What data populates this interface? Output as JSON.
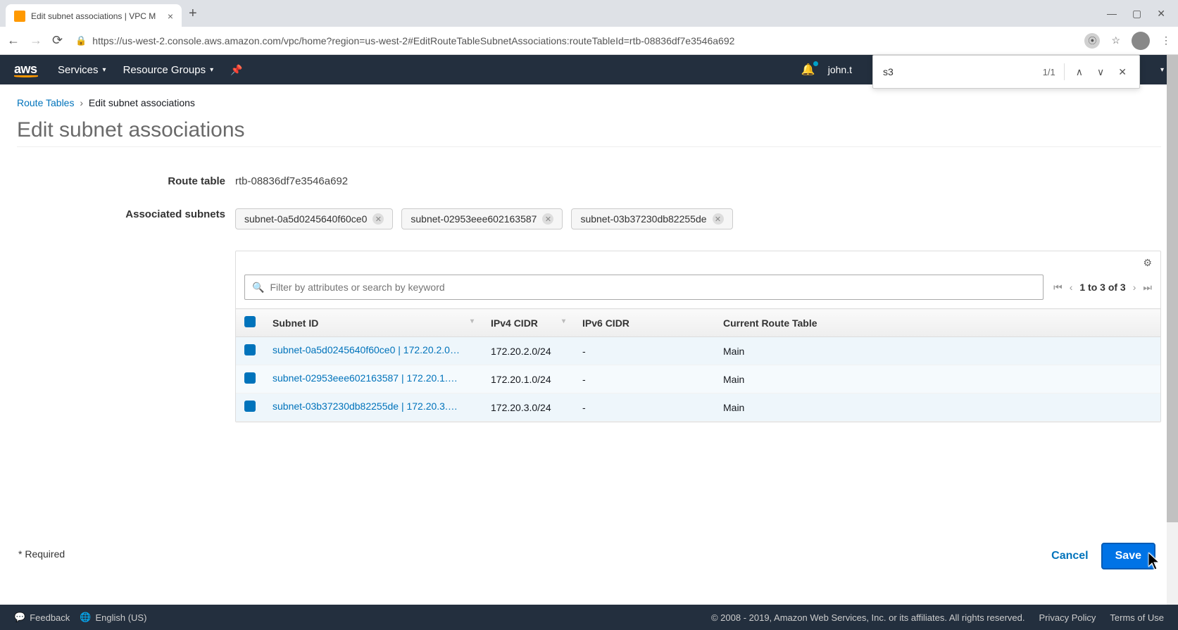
{
  "browser": {
    "tab_title": "Edit subnet associations | VPC M",
    "url_display": "https://us-west-2.console.aws.amazon.com/vpc/home?region=us-west-2#EditRouteTableSubnetAssociations:routeTableId=rtb-08836df7e3546a692"
  },
  "find": {
    "query": "s3",
    "count": "1/1"
  },
  "aws_header": {
    "services": "Services",
    "resource_groups": "Resource Groups",
    "user": "john.t"
  },
  "breadcrumb": {
    "root": "Route Tables",
    "current": "Edit subnet associations"
  },
  "page_title": "Edit subnet associations",
  "form": {
    "route_table_label": "Route table",
    "route_table_value": "rtb-08836df7e3546a692",
    "associated_label": "Associated subnets"
  },
  "associated_tags": [
    "subnet-0a5d0245640f60ce0",
    "subnet-02953eee602163587",
    "subnet-03b37230db82255de"
  ],
  "search": {
    "placeholder": "Filter by attributes or search by keyword"
  },
  "pagination": "1 to 3 of 3",
  "table": {
    "headers": {
      "subnet_id": "Subnet ID",
      "ipv4": "IPv4 CIDR",
      "ipv6": "IPv6 CIDR",
      "current": "Current Route Table"
    },
    "rows": [
      {
        "subnet": "subnet-0a5d0245640f60ce0 | 172.20.2.0…",
        "ipv4": "172.20.2.0/24",
        "ipv6": "-",
        "rt": "Main"
      },
      {
        "subnet": "subnet-02953eee602163587 | 172.20.1.…",
        "ipv4": "172.20.1.0/24",
        "ipv6": "-",
        "rt": "Main"
      },
      {
        "subnet": "subnet-03b37230db82255de | 172.20.3.…",
        "ipv4": "172.20.3.0/24",
        "ipv6": "-",
        "rt": "Main"
      }
    ]
  },
  "required_note": "* Required",
  "buttons": {
    "cancel": "Cancel",
    "save": "Save"
  },
  "footer": {
    "feedback": "Feedback",
    "language": "English (US)",
    "copyright": "© 2008 - 2019, Amazon Web Services, Inc. or its affiliates. All rights reserved.",
    "privacy": "Privacy Policy",
    "terms": "Terms of Use"
  }
}
